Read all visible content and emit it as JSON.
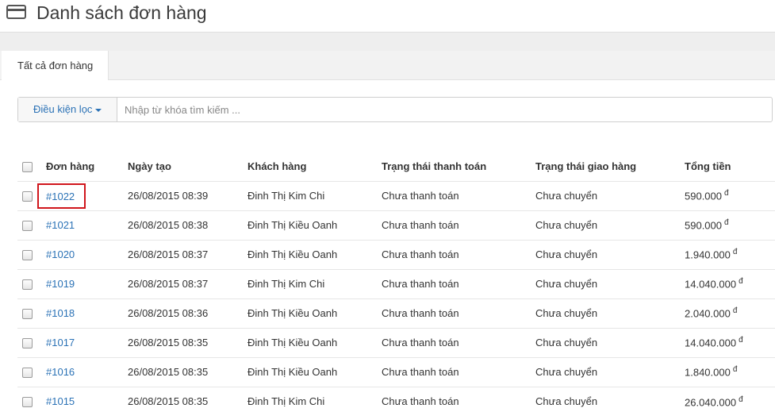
{
  "header": {
    "title": "Danh sách đơn hàng",
    "icon": "credit-card-icon"
  },
  "tabs": [
    {
      "label": "Tất cả đơn hàng"
    }
  ],
  "filter": {
    "button_label": "Điều kiện lọc",
    "search_placeholder": "Nhập từ khóa tìm kiếm ..."
  },
  "table": {
    "columns": [
      "Đơn hàng",
      "Ngày tạo",
      "Khách hàng",
      "Trạng thái thanh toán",
      "Trạng thái giao hàng",
      "Tổng tiền"
    ],
    "currency_symbol": "đ",
    "rows": [
      {
        "order": "#1022",
        "date": "26/08/2015 08:39",
        "customer": "Đinh Thị Kim Chi",
        "payment": "Chưa thanh toán",
        "shipping": "Chưa chuyển",
        "total": "590.000"
      },
      {
        "order": "#1021",
        "date": "26/08/2015 08:38",
        "customer": "Đinh Thị Kiều Oanh",
        "payment": "Chưa thanh toán",
        "shipping": "Chưa chuyển",
        "total": "590.000"
      },
      {
        "order": "#1020",
        "date": "26/08/2015 08:37",
        "customer": "Đinh Thị Kiều Oanh",
        "payment": "Chưa thanh toán",
        "shipping": "Chưa chuyển",
        "total": "1.940.000"
      },
      {
        "order": "#1019",
        "date": "26/08/2015 08:37",
        "customer": "Đinh Thị Kim Chi",
        "payment": "Chưa thanh toán",
        "shipping": "Chưa chuyển",
        "total": "14.040.000"
      },
      {
        "order": "#1018",
        "date": "26/08/2015 08:36",
        "customer": "Đinh Thị Kiều Oanh",
        "payment": "Chưa thanh toán",
        "shipping": "Chưa chuyển",
        "total": "2.040.000"
      },
      {
        "order": "#1017",
        "date": "26/08/2015 08:35",
        "customer": "Đinh Thị Kiều Oanh",
        "payment": "Chưa thanh toán",
        "shipping": "Chưa chuyển",
        "total": "14.040.000"
      },
      {
        "order": "#1016",
        "date": "26/08/2015 08:35",
        "customer": "Đinh Thị Kiều Oanh",
        "payment": "Chưa thanh toán",
        "shipping": "Chưa chuyển",
        "total": "1.840.000"
      },
      {
        "order": "#1015",
        "date": "26/08/2015 08:35",
        "customer": "Đinh Thị Kim Chi",
        "payment": "Chưa thanh toán",
        "shipping": "Chưa chuyển",
        "total": "26.040.000"
      }
    ]
  },
  "colors": {
    "link": "#2b72b6",
    "highlight_border": "#d0161c"
  }
}
